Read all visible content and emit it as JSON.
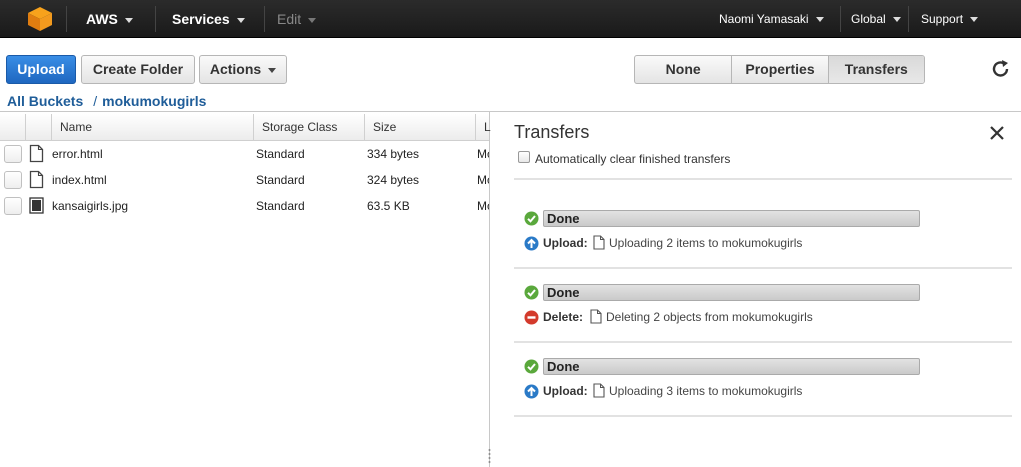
{
  "topnav": {
    "brand": "AWS",
    "services": "Services",
    "edit": "Edit",
    "user": "Naomi Yamasaki",
    "region": "Global",
    "support": "Support"
  },
  "toolbar": {
    "upload": "Upload",
    "create_folder": "Create Folder",
    "actions": "Actions"
  },
  "view_toggle": {
    "none": "None",
    "properties": "Properties",
    "transfers": "Transfers",
    "selected": "Transfers"
  },
  "breadcrumb": {
    "root": "All Buckets",
    "separator": "/",
    "bucket": "mokumokugirls"
  },
  "table": {
    "columns": [
      "Name",
      "Storage Class",
      "Size",
      "L"
    ],
    "rows": [
      {
        "name": "error.html",
        "storage_class": "Standard",
        "size": "334 bytes",
        "last": "Mo",
        "icon": "document-icon"
      },
      {
        "name": "index.html",
        "storage_class": "Standard",
        "size": "324 bytes",
        "last": "Mo",
        "icon": "document-icon"
      },
      {
        "name": "kansaigirls.jpg",
        "storage_class": "Standard",
        "size": "63.5 KB",
        "last": "Mo",
        "icon": "image-icon"
      }
    ]
  },
  "transfers": {
    "title": "Transfers",
    "auto_clear_label": "Automatically clear finished transfers",
    "items": [
      {
        "status": "Done",
        "op": "Upload:",
        "op_icon": "upload-arrow-icon",
        "text": "Uploading 2 items to mokumokugirls",
        "progress": 1.0
      },
      {
        "status": "Done",
        "op": "Delete:",
        "op_icon": "delete-icon",
        "text": "Deleting 2 objects from mokumokugirls",
        "progress": 1.0
      },
      {
        "status": "Done",
        "op": "Upload:",
        "op_icon": "upload-arrow-icon",
        "text": "Uploading 3 items to mokumokugirls",
        "progress": 1.0
      }
    ]
  },
  "colors": {
    "topbar": "#232323",
    "primary": "#1f67c0",
    "link": "#1f5d99",
    "ok": "#5aa83c",
    "delete": "#d33a2c"
  }
}
